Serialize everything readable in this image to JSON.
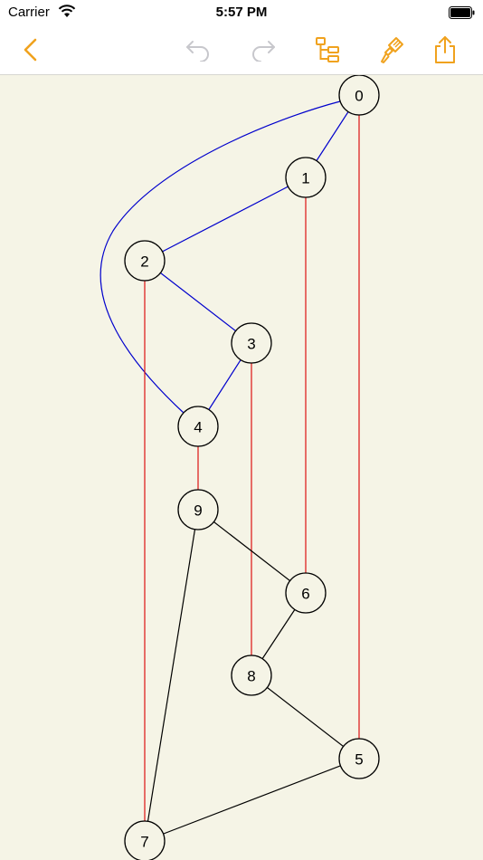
{
  "status_bar": {
    "carrier": "Carrier",
    "time": "5:57 PM"
  },
  "toolbar": {
    "accent_color": "#f0a21e",
    "disabled_color": "#c7c7cc",
    "buttons": [
      {
        "name": "back-button",
        "icon": "chevron-left-icon"
      },
      {
        "name": "undo-button",
        "icon": "undo-icon",
        "disabled": true
      },
      {
        "name": "redo-button",
        "icon": "redo-icon",
        "disabled": true
      },
      {
        "name": "layout-tree-button",
        "icon": "tree-layout-icon"
      },
      {
        "name": "style-brush-button",
        "icon": "paintbrush-icon"
      },
      {
        "name": "share-button",
        "icon": "share-icon"
      }
    ]
  },
  "graph": {
    "background": "#f5f4e6",
    "edge_colors": {
      "blue": "#0000cc",
      "red": "#dd1111",
      "black": "#000000"
    },
    "nodes": [
      {
        "id": "0",
        "label": "0"
      },
      {
        "id": "1",
        "label": "1"
      },
      {
        "id": "2",
        "label": "2"
      },
      {
        "id": "3",
        "label": "3"
      },
      {
        "id": "4",
        "label": "4"
      },
      {
        "id": "9",
        "label": "9"
      },
      {
        "id": "6",
        "label": "6"
      },
      {
        "id": "8",
        "label": "8"
      },
      {
        "id": "5",
        "label": "5"
      },
      {
        "id": "7",
        "label": "7"
      }
    ],
    "edges": [
      {
        "from": "0",
        "to": "1",
        "color": "blue"
      },
      {
        "from": "1",
        "to": "2",
        "color": "blue"
      },
      {
        "from": "2",
        "to": "3",
        "color": "blue"
      },
      {
        "from": "3",
        "to": "4",
        "color": "blue"
      },
      {
        "from": "0",
        "to": "4",
        "color": "blue"
      },
      {
        "from": "0",
        "to": "5",
        "color": "red"
      },
      {
        "from": "1",
        "to": "6",
        "color": "red"
      },
      {
        "from": "2",
        "to": "7",
        "color": "red"
      },
      {
        "from": "3",
        "to": "8",
        "color": "red"
      },
      {
        "from": "4",
        "to": "9",
        "color": "red"
      },
      {
        "from": "9",
        "to": "6",
        "color": "black"
      },
      {
        "from": "6",
        "to": "8",
        "color": "black"
      },
      {
        "from": "8",
        "to": "5",
        "color": "black"
      },
      {
        "from": "5",
        "to": "7",
        "color": "black"
      },
      {
        "from": "7",
        "to": "9",
        "color": "black"
      }
    ]
  }
}
